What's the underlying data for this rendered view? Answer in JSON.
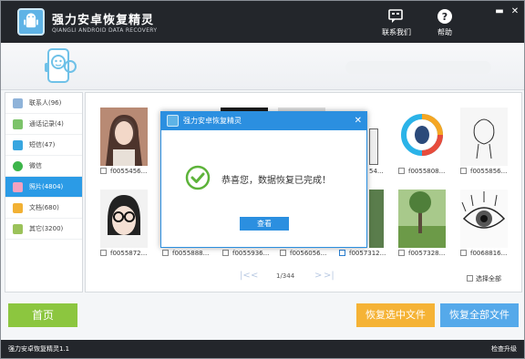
{
  "app": {
    "title": "强力安卓恢复精灵",
    "subtitle": "QIANGLI ANDROID DATA RECOVERY"
  },
  "toolbar": {
    "contact_label": "联系我们",
    "help_label": "帮助",
    "minimize": "▬",
    "close": "✕"
  },
  "sidebar": {
    "items": [
      {
        "label": "联系人(96)",
        "color": "#8fb3d9"
      },
      {
        "label": "通话记录(4)",
        "color": "#7cc36a"
      },
      {
        "label": "短信(47)",
        "color": "#38a6e0"
      },
      {
        "label": "微信",
        "color": "#3db54a"
      },
      {
        "label": "照片(4804)",
        "color": "#f4a1c0"
      },
      {
        "label": "文档(680)",
        "color": "#f2b134"
      },
      {
        "label": "其它(3200)",
        "color": "#9bc25a"
      }
    ]
  },
  "thumbnails": [
    {
      "label": "f0055456...",
      "checked": false
    },
    {
      "label": "",
      "checked": false
    },
    {
      "label": "",
      "checked": false
    },
    {
      "label": "",
      "checked": false
    },
    {
      "label": "54...",
      "checked": false
    },
    {
      "label": "f0055808...",
      "checked": false
    },
    {
      "label": "f0055856...",
      "checked": false
    },
    {
      "label": "f0055872...",
      "checked": false
    },
    {
      "label": "f0055888...",
      "checked": false
    },
    {
      "label": "f0055936...",
      "checked": false
    },
    {
      "label": "f0056056...",
      "checked": false
    },
    {
      "label": "f0057312...",
      "checked": true
    },
    {
      "label": "f0057328...",
      "checked": false
    },
    {
      "label": "f0068816...",
      "checked": false
    }
  ],
  "pager": {
    "first": "|<",
    "prev": "<",
    "page_text": "1/344",
    "next": ">",
    "last": ">|"
  },
  "select_all_label": "选择全部",
  "buttons": {
    "home": "首页",
    "recover_selected": "恢复选中文件",
    "recover_all": "恢复全部文件"
  },
  "statusbar": {
    "version": "强力安卓恢复精灵1.1",
    "check_update": "检查升级"
  },
  "dialog": {
    "title": "强力安卓恢复精灵",
    "close": "✕",
    "message": "恭喜您，数据恢复已完成！",
    "view_button": "查看"
  },
  "colors": {
    "titlebar": "#23262b",
    "accent_blue": "#2b8fe0",
    "home_green": "#8cc63f",
    "orange": "#f5b336",
    "light_blue": "#55a9ea"
  }
}
